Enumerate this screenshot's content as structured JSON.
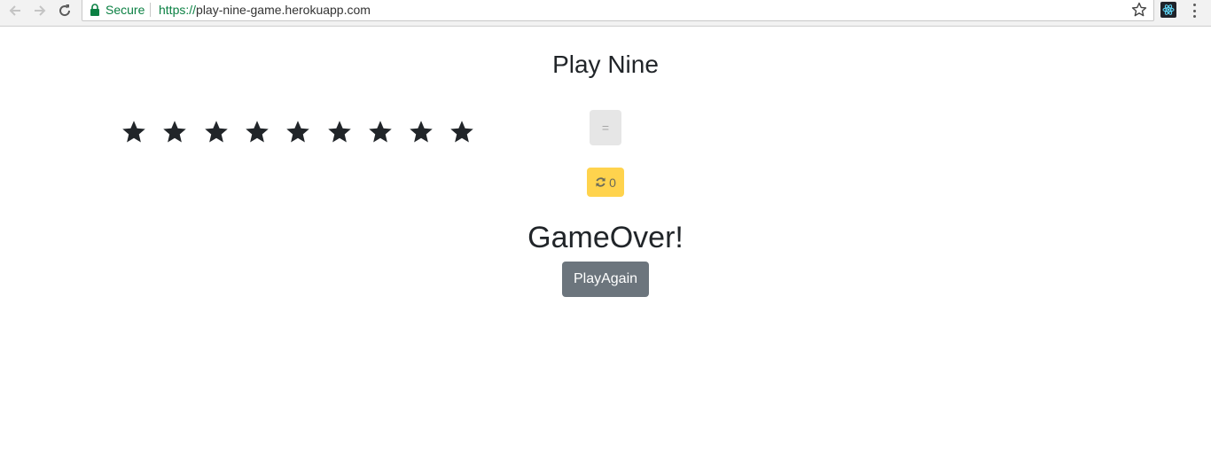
{
  "browser": {
    "secure_label": "Secure",
    "url_scheme": "https://",
    "url_host": "play-nine-game.herokuapp.com",
    "icons": {
      "back": "arrow-left-icon",
      "forward": "arrow-right-icon",
      "reload": "reload-icon",
      "lock": "lock-icon",
      "bookmark": "star-outline-icon",
      "extension": "react-devtools-icon",
      "menu": "more-vert-icon"
    }
  },
  "game": {
    "title": "Play Nine",
    "star_count": 9,
    "stars_icon": "star-icon",
    "equals_label": "=",
    "redraw_icon": "refresh-icon",
    "redraws_left": "0",
    "status_text": "GameOver!",
    "play_again_label": "PlayAgain"
  },
  "colors": {
    "star": "#212529",
    "equals_bg": "#e6e6e6",
    "redraw_bg": "#ffd34d",
    "play_again_bg": "#6c757d",
    "secure_green": "#0b8043"
  }
}
